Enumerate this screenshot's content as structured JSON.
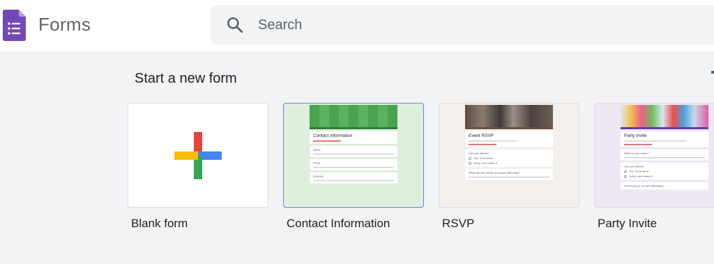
{
  "app": {
    "name": "Forms",
    "accent": "#7248b9"
  },
  "search": {
    "placeholder": "Search"
  },
  "gallery": {
    "section_title": "Start a new form",
    "templates": [
      {
        "label": "Blank form"
      },
      {
        "label": "Contact Information"
      },
      {
        "label": "RSVP"
      },
      {
        "label": "Party Invite"
      }
    ]
  },
  "previews": {
    "contact": {
      "title": "Contact information",
      "questions": [
        "Name",
        "Email",
        "Address"
      ]
    },
    "rsvp": {
      "title": "Event RSVP",
      "questions": [
        "Can you attend?",
        "What are the names of people attending?"
      ],
      "options": [
        "Yes, I'll be there",
        "Sorry, can't make it"
      ]
    },
    "party": {
      "title": "Party Invite",
      "questions": [
        "What is your name?",
        "Can you attend?",
        "How many of you are attending?"
      ],
      "options": [
        "Yes, I'll be there",
        "Sorry, can't make it"
      ]
    }
  },
  "colors": {
    "plus_red": "#ea4335",
    "plus_blue": "#4285f4",
    "plus_green": "#34a853",
    "plus_yellow": "#fbbc04",
    "contact_green": "#43a047",
    "rsvp_accent": "#6d4c41",
    "party_accent": "#673ab7"
  }
}
